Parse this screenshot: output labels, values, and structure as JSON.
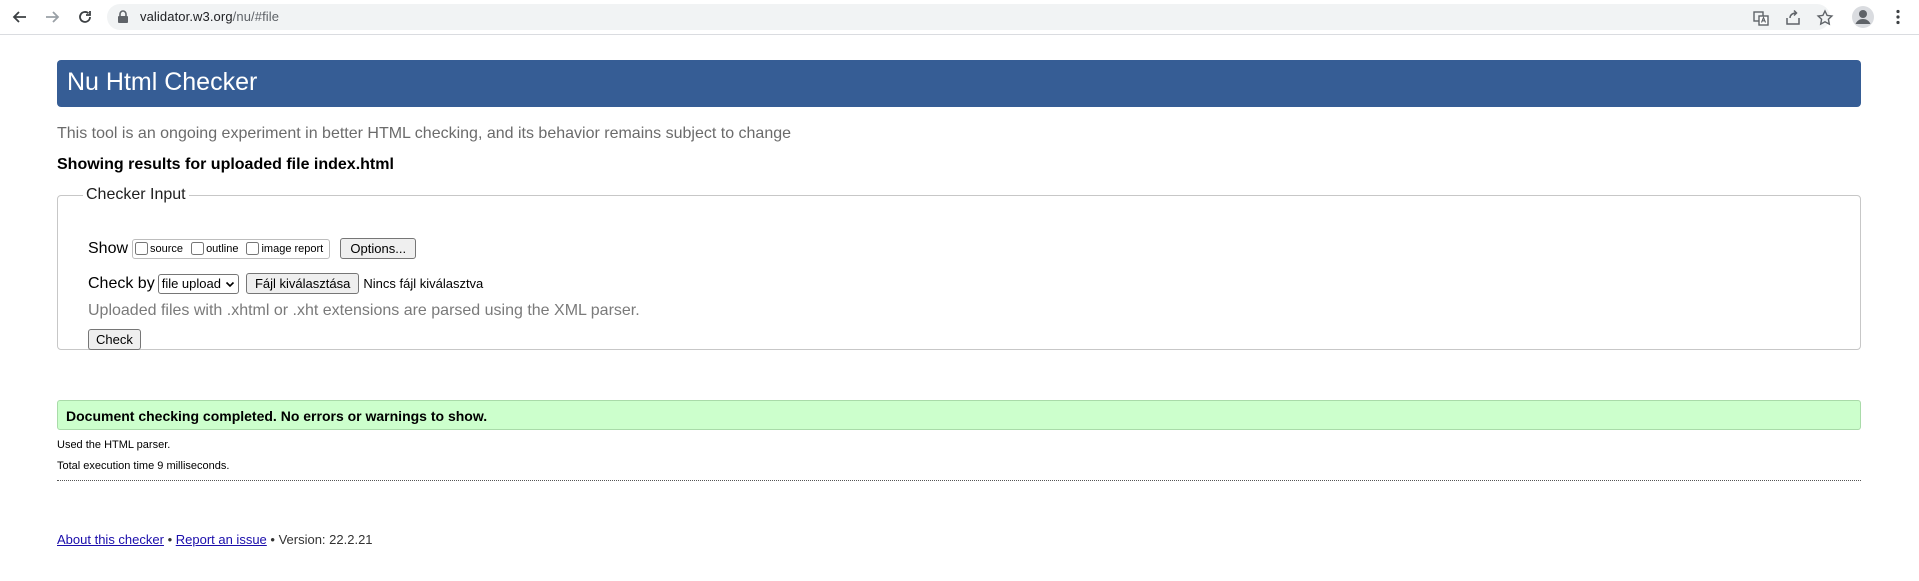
{
  "browser": {
    "url_host": "validator.w3.org",
    "url_path": "/nu/#file"
  },
  "page": {
    "title": "Nu Html Checker",
    "intro": "This tool is an ongoing experiment in better HTML checking, and its behavior remains subject to change",
    "showing": "Showing results for uploaded file index.html"
  },
  "checker": {
    "legend": "Checker Input",
    "show_label": "Show",
    "show_options": [
      "source",
      "outline",
      "image report"
    ],
    "options_button": "Options...",
    "check_by_label": "Check by",
    "check_by_value": "file upload",
    "file_button": "Fájl kiválasztása",
    "file_status": "Nincs fájl kiválasztva",
    "xml_note": "Uploaded files with .xhtml or .xht extensions are parsed using the XML parser.",
    "check_button": "Check"
  },
  "result": {
    "message": "Document checking completed. No errors or warnings to show.",
    "parser_note": "Used the HTML parser.",
    "time_note": "Total execution time 9 milliseconds."
  },
  "footer": {
    "about": "About this checker",
    "bullet1": " • ",
    "report": "Report an issue",
    "version": " • Version: 22.2.21"
  },
  "colors": {
    "banner": "#365d95",
    "success_bg": "#ccffcc"
  }
}
